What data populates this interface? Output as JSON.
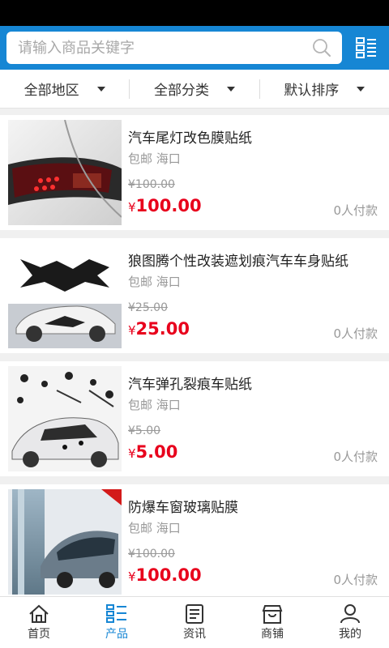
{
  "search": {
    "placeholder": "请输入商品关键字"
  },
  "filters": [
    "全部地区",
    "全部分类",
    "默认排序"
  ],
  "products": [
    {
      "title": "汽车尾灯改色膜贴纸",
      "ship": "包邮 海口",
      "old_price": "¥100.00",
      "currency": "¥",
      "price": "100.00",
      "sold": "0人付款"
    },
    {
      "title": "狼图腾个性改装遮划痕汽车车身贴纸",
      "ship": "包邮 海口",
      "old_price": "¥25.00",
      "currency": "¥",
      "price": "25.00",
      "sold": "0人付款"
    },
    {
      "title": "汽车弹孔裂痕车贴纸",
      "ship": "包邮 海口",
      "old_price": "¥5.00",
      "currency": "¥",
      "price": "5.00",
      "sold": "0人付款"
    },
    {
      "title": "防爆车窗玻璃贴膜",
      "ship": "包邮 海口",
      "old_price": "¥100.00",
      "currency": "¥",
      "price": "100.00",
      "sold": "0人付款"
    }
  ],
  "nav": [
    {
      "label": "首页",
      "icon": "home-icon"
    },
    {
      "label": "产品",
      "icon": "product-list-icon"
    },
    {
      "label": "资讯",
      "icon": "news-icon"
    },
    {
      "label": "商铺",
      "icon": "shop-icon"
    },
    {
      "label": "我的",
      "icon": "user-icon"
    }
  ],
  "colors": {
    "brand": "#1686d4",
    "price": "#e8001c",
    "muted": "#999999"
  }
}
